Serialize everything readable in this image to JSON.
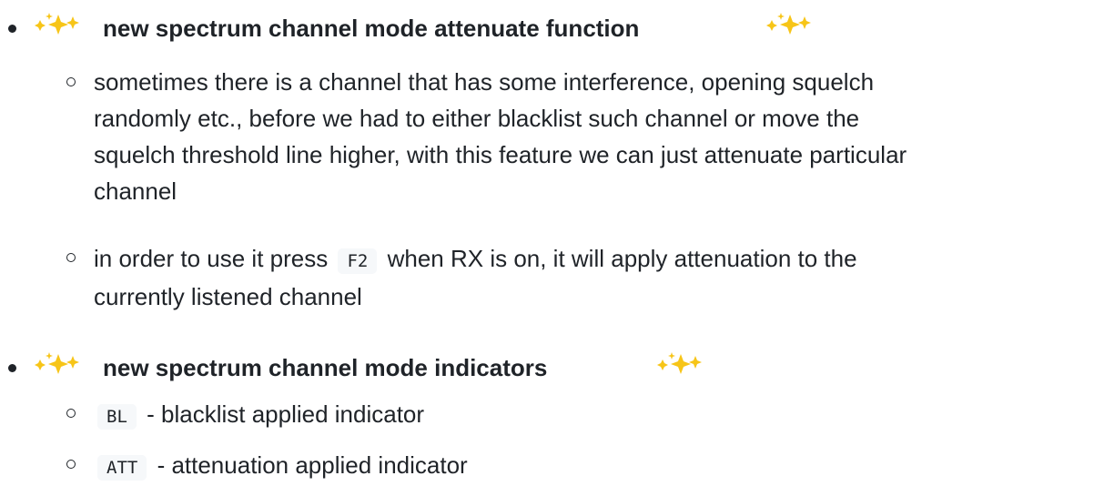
{
  "sections": [
    {
      "title": "new spectrum channel mode attenuate function",
      "items": [
        {
          "lines": [
            "sometimes there is a channel that has some interference, opening squelch",
            "randomly etc., before we had to either blacklist such channel or move the",
            "squelch threshold line higher, with this feature we can just attenuate particular",
            "channel"
          ]
        },
        {
          "line1_before": "in order to use it press",
          "line1_code": "F2",
          "line1_after": "when RX is on, it will apply attenuation to the",
          "line2": "currently listened channel"
        }
      ]
    },
    {
      "title": "new spectrum channel mode indicators",
      "items": [
        {
          "code": "BL",
          "text": "- blacklist applied indicator"
        },
        {
          "code": "ATT",
          "text": "- attenuation applied indicator"
        }
      ]
    }
  ],
  "icons": {
    "sparkle_color": "#f7c518",
    "sparkle_outline": "#f08c00"
  }
}
